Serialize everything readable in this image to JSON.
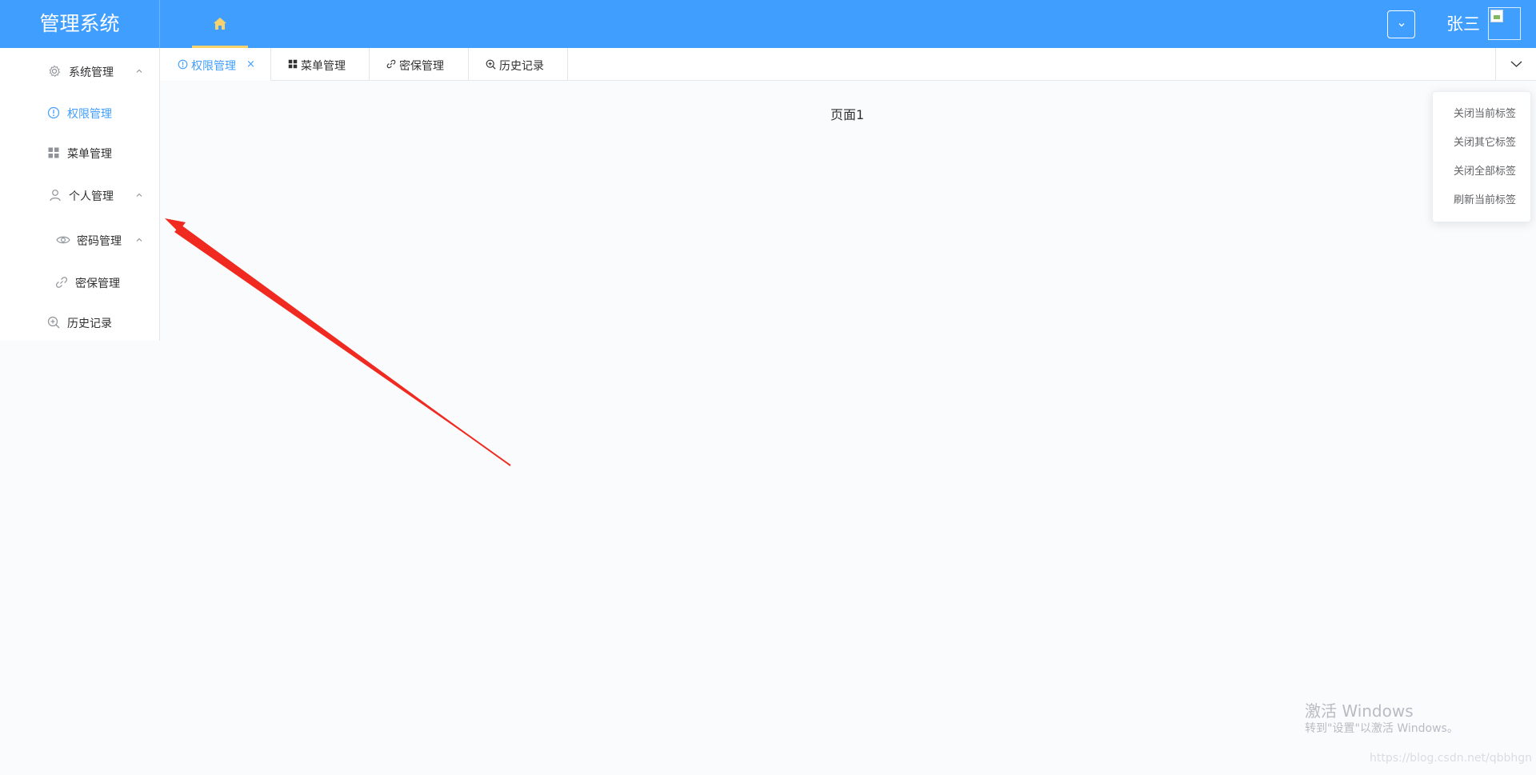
{
  "header": {
    "title": "管理系统",
    "user_name": "张三",
    "colors": {
      "bg": "#409eff",
      "home_underline": "#f7d26b"
    }
  },
  "sidebar": {
    "items": [
      {
        "label": "系统管理",
        "icon": "gear-icon",
        "expanded": true
      },
      {
        "label": "权限管理",
        "icon": "info-circle-icon",
        "active": true
      },
      {
        "label": "菜单管理",
        "icon": "grid-icon"
      },
      {
        "label": "个人管理",
        "icon": "user-icon",
        "expanded": true
      },
      {
        "label": "密码管理",
        "icon": "eye-icon",
        "expanded": true
      },
      {
        "label": "密保管理",
        "icon": "link-icon"
      },
      {
        "label": "历史记录",
        "icon": "zoom-in-icon"
      }
    ]
  },
  "tabs": [
    {
      "label": "权限管理",
      "icon": "info-circle-icon",
      "active": true,
      "closable": true,
      "close_symbol": "×"
    },
    {
      "label": "菜单管理",
      "icon": "grid-icon"
    },
    {
      "label": "密保管理",
      "icon": "link-icon"
    },
    {
      "label": "历史记录",
      "icon": "zoom-in-icon"
    }
  ],
  "context_menu": {
    "items": [
      "关闭当前标签",
      "关闭其它标签",
      "关闭全部标签",
      "刷新当前标签"
    ]
  },
  "content": {
    "page_text": "页面1"
  },
  "watermark": {
    "line1": "激活 Windows",
    "line2": "转到\"设置\"以激活 Windows。",
    "url": "https://blog.csdn.net/qbbhgn"
  }
}
